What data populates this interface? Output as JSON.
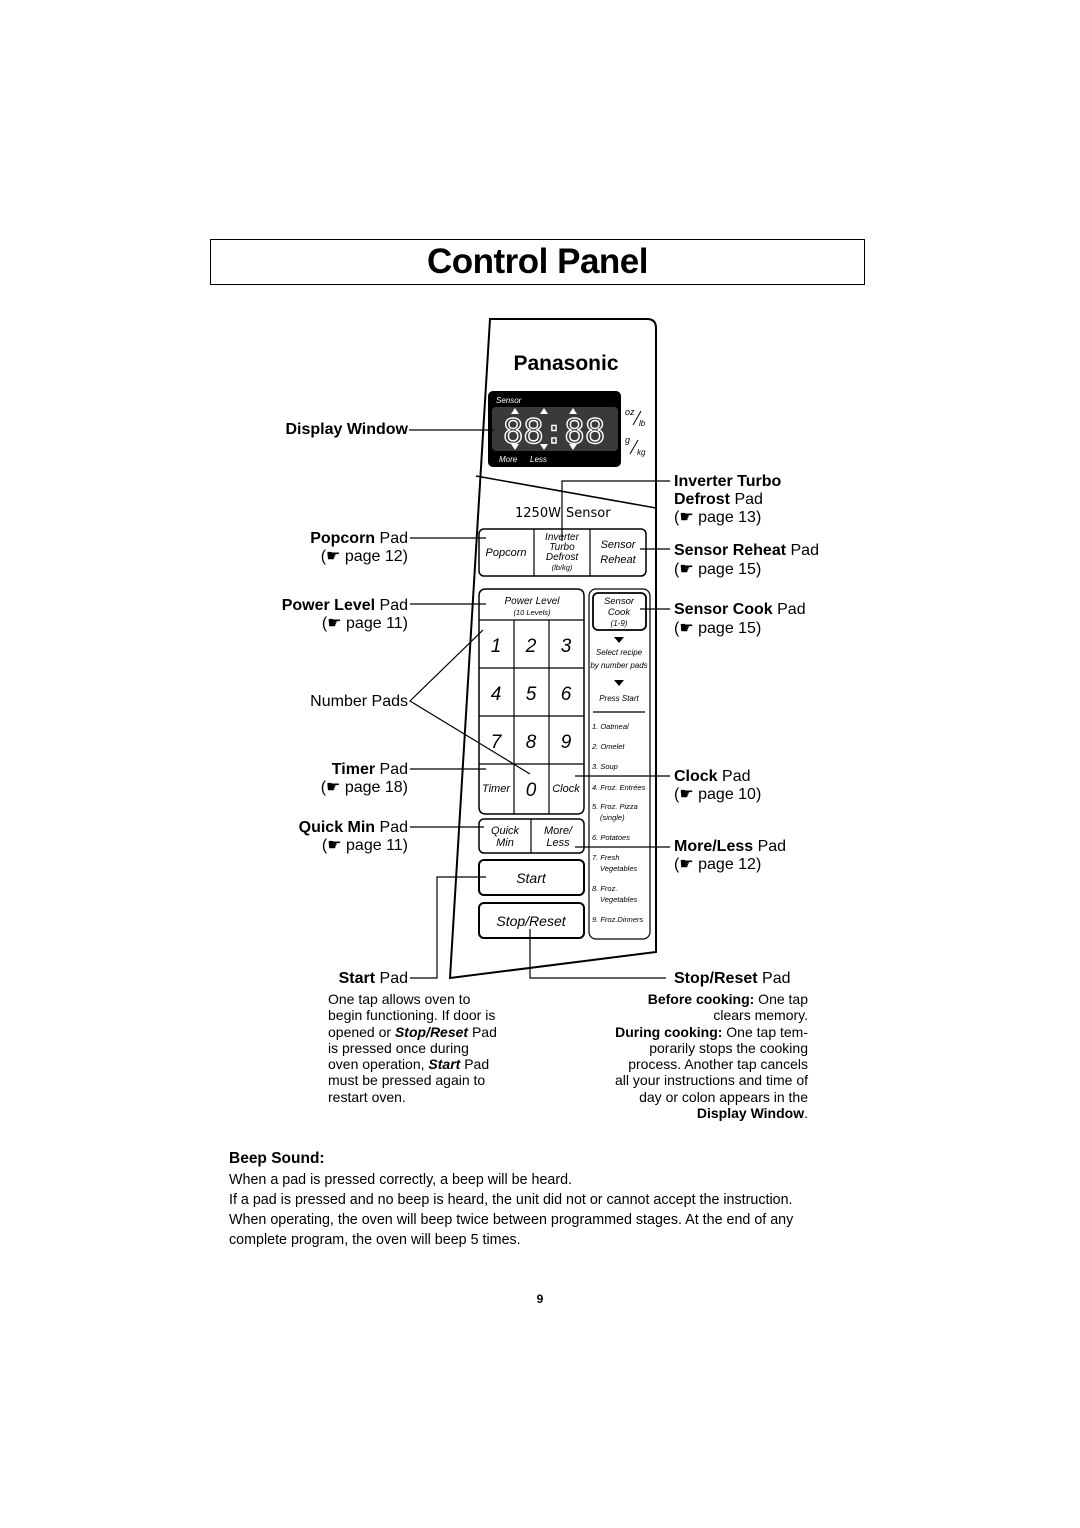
{
  "page_title": "Control Panel",
  "panel": {
    "brand": "Panasonic",
    "display": {
      "top_label": "Sensor",
      "digits": "88:88",
      "bottom_labels": [
        "More",
        "Less"
      ],
      "unit_oz": "oz",
      "unit_lb": "lb",
      "unit_g": "g",
      "unit_kg": "kg"
    },
    "model_label_power": "1250W",
    "model_label_sensor": "Sensor",
    "pads": {
      "popcorn": "Popcorn",
      "inverter_line1": "Inverter",
      "inverter_line2": "Turbo",
      "inverter_line3": "Defrost",
      "inverter_line4": "(lb/kg)",
      "sensor_reheat_line1": "Sensor",
      "sensor_reheat_line2": "Reheat",
      "power_level_line1": "Power Level",
      "power_level_line2": "(10 Levels)",
      "numbers": [
        "1",
        "2",
        "3",
        "4",
        "5",
        "6",
        "7",
        "8",
        "9"
      ],
      "timer": "Timer",
      "zero": "0",
      "clock": "Clock",
      "quick_line1": "Quick",
      "quick_line2": "Min",
      "more_line1": "More/",
      "more_line2": "Less",
      "start": "Start",
      "stop_reset": "Stop/Reset",
      "sensor_cook_line1": "Sensor",
      "sensor_cook_line2": "Cook",
      "sensor_cook_line3": "(1-9)"
    },
    "sensor_cook_instructions": {
      "step1_line1": "Select recipe",
      "step1_line2": "by number pads",
      "step2": "Press Start"
    },
    "recipes": [
      {
        "line1": "1. Oatmeal",
        "line2": ""
      },
      {
        "line1": "2. Omelet",
        "line2": ""
      },
      {
        "line1": "3. Soup",
        "line2": ""
      },
      {
        "line1": "4. Froz. Entrées",
        "line2": ""
      },
      {
        "line1": "5. Froz. Pizza",
        "line2": "(single)"
      },
      {
        "line1": "6. Potatoes",
        "line2": ""
      },
      {
        "line1": "7. Fresh",
        "line2": "Vegetables"
      },
      {
        "line1": "8. Froz.",
        "line2": "Vegetables"
      },
      {
        "line1": "9. Froz.Dinners",
        "line2": ""
      }
    ]
  },
  "callouts": {
    "display_window": {
      "bold": "Display Window",
      "normal": "",
      "page": ""
    },
    "popcorn": {
      "bold": "Popcorn",
      "normal": " Pad",
      "page": "(☛ page 12)"
    },
    "power_level": {
      "bold": "Power Level",
      "normal": " Pad",
      "page": "(☛ page 11)"
    },
    "number_pads": {
      "normal": "Number Pads"
    },
    "timer": {
      "bold": "Timer",
      "normal": " Pad",
      "page": "(☛ page 18)"
    },
    "quick_min": {
      "bold": "Quick Min",
      "normal": " Pad",
      "page": "(☛ page 11)"
    },
    "start": {
      "bold": "Start",
      "normal": " Pad"
    },
    "inverter": {
      "bold_line1": "Inverter Turbo",
      "bold_line2": "Defrost",
      "normal": " Pad",
      "page": "(☛ page 13)"
    },
    "sensor_reheat": {
      "bold": "Sensor Reheat",
      "normal": " Pad",
      "page": "(☛ page 15)"
    },
    "sensor_cook": {
      "bold": "Sensor Cook",
      "normal": " Pad",
      "page": "(☛ page 15)"
    },
    "clock": {
      "bold": "Clock",
      "normal": " Pad",
      "page": "(☛ page 10)"
    },
    "more_less": {
      "bold": "More/Less",
      "normal": " Pad",
      "page": "(☛ page 12)"
    },
    "stop_reset": {
      "bold": "Stop/Reset",
      "normal": " Pad"
    }
  },
  "start_description": {
    "line1": "One tap allows oven to",
    "line2": "begin functioning. If door is",
    "line3_pre": "opened or ",
    "line3_em": "Stop/Reset",
    "line3_post": " Pad",
    "line4": "is pressed once during",
    "line5_pre": "oven operation, ",
    "line5_em": "Start",
    "line5_post": " Pad",
    "line6": "must be pressed again to",
    "line7": "restart oven."
  },
  "stop_description": {
    "before_bold": "Before cooking:",
    "before_text": " One tap",
    "line2": "clears memory.",
    "during_bold": "During cooking:",
    "during_text": " One tap tem-",
    "line4": "porarily stops the cooking",
    "line5": "process. Another tap cancels",
    "line6": "all your instructions and time of",
    "line7": "day or colon appears in the",
    "line8_bold": "Display Window",
    "line8_end": "."
  },
  "beep_sound": {
    "title": "Beep Sound:",
    "lines": [
      "When a pad is pressed correctly, a beep will be heard.",
      "If a pad is pressed and no beep is heard, the unit did not or cannot accept the instruction.",
      "When operating, the oven will beep twice between programmed stages. At the end of any",
      "complete program, the oven will beep 5 times."
    ]
  },
  "page_number": "9"
}
